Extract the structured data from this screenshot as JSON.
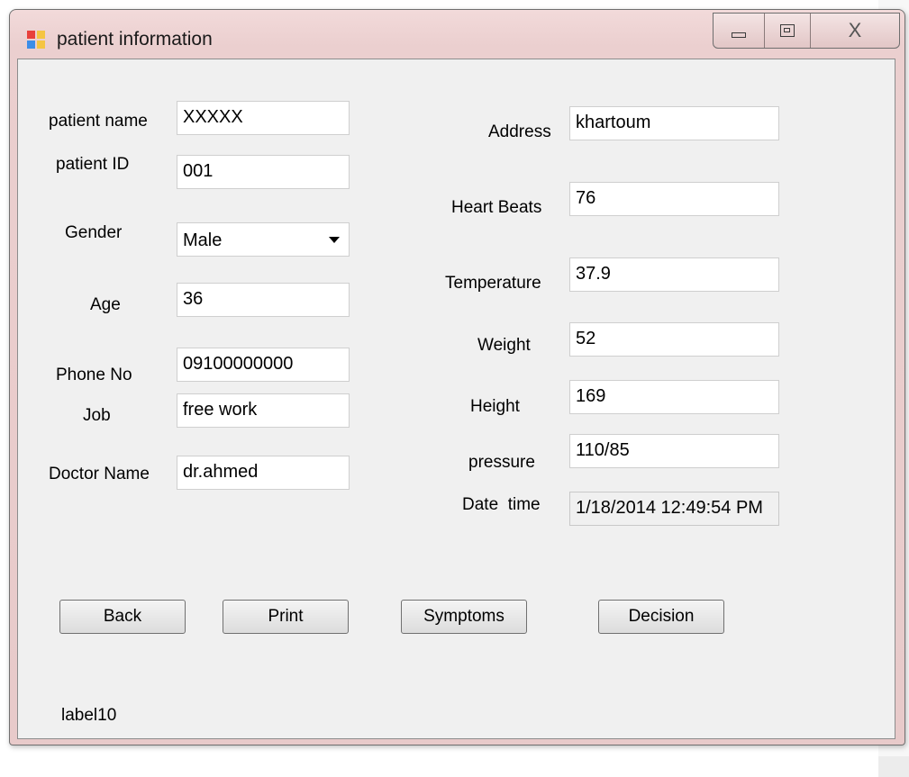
{
  "window": {
    "title": "patient information",
    "close_glyph": "X",
    "icons": {
      "app": "app-form-icon",
      "minimize": "minimize-icon",
      "maximize": "maximize-icon",
      "close": "close-icon"
    }
  },
  "form": {
    "patient_name": {
      "label": "patient name",
      "value": "XXXXX"
    },
    "patient_id": {
      "label": "patient ID",
      "value": "001"
    },
    "gender": {
      "label": "Gender",
      "value": "Male"
    },
    "age": {
      "label": "Age",
      "value": "36"
    },
    "phone": {
      "label": "Phone No",
      "value": "09100000000"
    },
    "job": {
      "label": "Job",
      "value": "free work"
    },
    "doctor_name": {
      "label": "Doctor Name",
      "value": "dr.ahmed"
    },
    "address": {
      "label": "Address",
      "value": "khartoum"
    },
    "heart_beats": {
      "label": "Heart Beats",
      "value": "76"
    },
    "temperature": {
      "label": "Temperature",
      "value": "37.9"
    },
    "weight": {
      "label": "Weight",
      "value": "52"
    },
    "height": {
      "label": "Height",
      "value": "169"
    },
    "pressure": {
      "label": "pressure",
      "value": "110/85"
    },
    "date_time": {
      "label": "Date  time",
      "value": "1/18/2014 12:49:54 PM"
    }
  },
  "buttons": {
    "back": "Back",
    "print": "Print",
    "symptoms": "Symptoms",
    "decision": "Decision"
  },
  "status_label": "label10",
  "colors": {
    "frame": "#ebcfcf",
    "client": "#f0f0f0",
    "input_bg": "#ffffff"
  }
}
